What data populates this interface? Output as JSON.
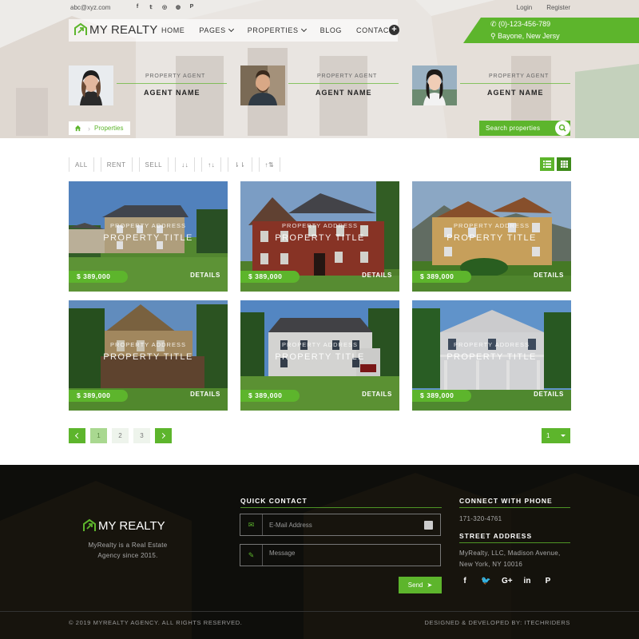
{
  "topbar": {
    "email": "abc@xyz.com",
    "social_icons": [
      "facebook-icon",
      "twitter-icon",
      "instagram-icon",
      "dribbble-icon",
      "pinterest-icon"
    ],
    "social_glyphs": [
      "f",
      "𝕥",
      "◎",
      "◍",
      "P"
    ],
    "login": "Login",
    "register": "Register"
  },
  "brand": {
    "name": "MY REALTY",
    "accent": "#5db52c"
  },
  "nav": {
    "home": "HOME",
    "pages": "PAGES",
    "properties": "PROPERTIES",
    "blog": "BLOG",
    "contact": "CONTACT"
  },
  "contact": {
    "phone": "(0)-123-456-789",
    "address": "Bayone, New Jersy"
  },
  "agents": [
    {
      "role": "PROPERTY AGENT",
      "name": "AGENT NAME"
    },
    {
      "role": "PROPERTY AGENT",
      "name": "AGENT NAME"
    },
    {
      "role": "PROPERTY AGENT",
      "name": "AGENT NAME"
    }
  ],
  "breadcrumb": {
    "current": "Properties"
  },
  "search": {
    "label": "Search properties"
  },
  "filters": {
    "all": "ALL",
    "rent": "RENT",
    "sell": "SELL",
    "sort1": "↓↓",
    "sort2": "↑↓",
    "sort3": "⇂⇂",
    "sort4": "↑⇅"
  },
  "cards": [
    {
      "address": "PROPERTY ADDRESS",
      "title": "PROPERTY TITLE",
      "price": "$ 389,000",
      "details": "DETAILS"
    },
    {
      "address": "PROPERTY ADDRESS",
      "title": "PROPERTY TITLE",
      "price": "$ 389,000",
      "details": "DETAILS"
    },
    {
      "address": "PROPERTY ADDRESS",
      "title": "PROPERTY TITLE",
      "price": "$ 389,000",
      "details": "DETAILS"
    },
    {
      "address": "PROPERTY ADDRESS",
      "title": "PROPERTY TITLE",
      "price": "$ 389,000",
      "details": "DETAILS"
    },
    {
      "address": "PROPERTY ADDRESS",
      "title": "PROPERTY TITLE",
      "price": "$ 389,000",
      "details": "DETAILS"
    },
    {
      "address": "PROPERTY ADDRESS",
      "title": "PROPERTY TITLE",
      "price": "$ 389,000",
      "details": "DETAILS"
    }
  ],
  "pagination": {
    "pages": [
      "1",
      "2",
      "3"
    ],
    "selected": "1"
  },
  "footer": {
    "brand": "MY REALTY",
    "about": "MyRealty is a Real Estate Agency since 2015.",
    "quick_contact": "QUICK CONTACT",
    "email_placeholder": "E-Mail Address",
    "message_placeholder": "Message",
    "send": "Send",
    "connect_phone": "CONNECT WITH PHONE",
    "phone": "171-320-4761",
    "street_address_heading": "STREET ADDRESS",
    "street_line1": "MyRealty, LLC, Madison Avenue,",
    "street_line2": "New York, NY 10016",
    "socials": [
      "f",
      "🐦",
      "G+",
      "in",
      "P"
    ],
    "copyright": "© 2019 MYREALTY AGENCY. ALL RIGHTS RESERVED.",
    "credit": "DESIGNED & DEVELOPED BY: ITECHRIDERS"
  }
}
